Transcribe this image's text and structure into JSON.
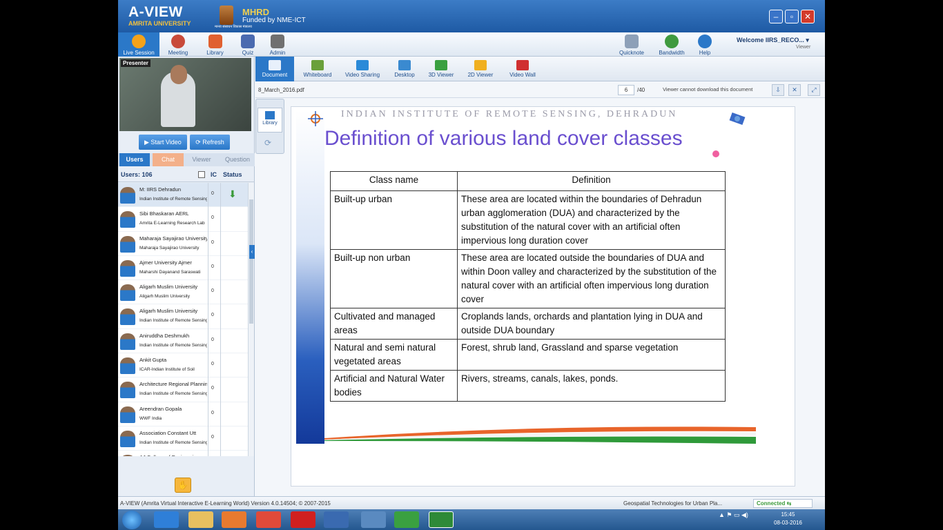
{
  "app": {
    "brand_title": "A-VIEW",
    "brand_sub": "AMRITA UNIVERSITY",
    "mhrd_title": "MHRD",
    "mhrd_funded": "Funded by NME-ICT",
    "mhrd_caption": "मानव संसाधन विकास मंत्रालय",
    "window_buttons": {
      "minimize": "–",
      "maximize": "▫",
      "close": "✕"
    }
  },
  "main_toolbar": {
    "items": [
      "Live Session",
      "Meeting",
      "Library",
      "Quiz",
      "Admin"
    ],
    "right_items": [
      "Quicknote",
      "Bandwidth",
      "Help"
    ],
    "welcome": "Welcome IIRS_RECO...",
    "welcome_role": "Viewer"
  },
  "left_panel": {
    "presenter_label": "Presenter",
    "start_video": "Start Video",
    "refresh": "Refresh",
    "tabs": [
      "Users",
      "Chat",
      "Viewer",
      "Question"
    ],
    "users_count": "Users: 106",
    "col_ic": "IC",
    "col_status": "Status",
    "users": [
      {
        "name": "M: IIRS Dehradun",
        "org": "Indian Institute of Remote Sensing",
        "ic": "0",
        "status": "⬇"
      },
      {
        "name": "Sibi Bhaskaran AERL",
        "org": "Amrita E-Learning Research Lab",
        "ic": "0",
        "status": ""
      },
      {
        "name": "Maharaja Sayajirao University",
        "org": "Maharaja Sayajirao University",
        "ic": "0",
        "status": ""
      },
      {
        "name": "Ajmer University Ajmer",
        "org": "Maharshi Dayanand Saraswati",
        "ic": "0",
        "status": ""
      },
      {
        "name": "Aligarh Muslim University",
        "org": "Aligarh Muslim University",
        "ic": "0",
        "status": ""
      },
      {
        "name": "Aligarh Muslim University",
        "org": "Indian Institute of Remote Sensing",
        "ic": "0",
        "status": ""
      },
      {
        "name": "Aniruddha Deshmukh",
        "org": "Indian Institute of Remote Sensing",
        "ic": "0",
        "status": ""
      },
      {
        "name": "Ankit Gupta",
        "org": "ICAR-Indian Institute of Soil",
        "ic": "0",
        "status": ""
      },
      {
        "name": "Architecture Regional Planning",
        "org": "Indian Institute of Remote Sensing",
        "ic": "0",
        "status": ""
      },
      {
        "name": "Areendran Gopala",
        "org": "WWF India",
        "ic": "0",
        "status": ""
      },
      {
        "name": "Association Constant Utt",
        "org": "Indian Institute of Remote Sensing",
        "ic": "0",
        "status": ""
      },
      {
        "name": "AJ College of Engineering",
        "org": "",
        "ic": "",
        "status": ""
      }
    ],
    "raise_hand": "✋"
  },
  "content_toolbar": {
    "items": [
      "Document",
      "Whiteboard",
      "Video Sharing",
      "Desktop",
      "3D Viewer",
      "2D Viewer",
      "Video Wall"
    ]
  },
  "doc_bar": {
    "filename": "8_March_2016.pdf",
    "page": "6",
    "total": "/40",
    "note": "Viewer cannot download this document"
  },
  "library_side": {
    "label": "Library"
  },
  "slide": {
    "institute": "INDIAN INSTITUTE OF REMOTE SENSING, DEHRADUN",
    "heading": "Definition of various land cover classes",
    "col_class": "Class name",
    "col_def": "Definition",
    "rows": [
      {
        "cls": "Built-up urban",
        "def": "These area are located within the boundaries of Dehradun urban agglomeration (DUA) and characterized by the substitution of the natural cover with an artificial often impervious long duration cover"
      },
      {
        "cls": "Built-up non urban",
        "def": "These area are located outside the boundaries of DUA and within Doon valley and characterized by the substitution of the natural cover with an artificial often impervious long duration cover"
      },
      {
        "cls": "Cultivated and managed areas",
        "def": "Croplands lands, orchards and plantation lying in DUA and outside DUA boundary"
      },
      {
        "cls": "Natural and semi natural vegetated areas",
        "def": "Forest, shrub land, Grassland and sparse vegetation"
      },
      {
        "cls": "Artificial and Natural Water bodies",
        "def": "Rivers, streams, canals, lakes, ponds."
      }
    ]
  },
  "status_bar": {
    "version": "A-VIEW (Amrita Virtual Interactive E-Learning World) Version 4.0.14504; © 2007-2015",
    "course": "Geospatial Technologies for Urban Pla...",
    "connection": "Connected"
  },
  "taskbar": {
    "tray": "▲  ⚑  ▭  ◀)",
    "time": "15:45",
    "date": "08-03-2016"
  }
}
